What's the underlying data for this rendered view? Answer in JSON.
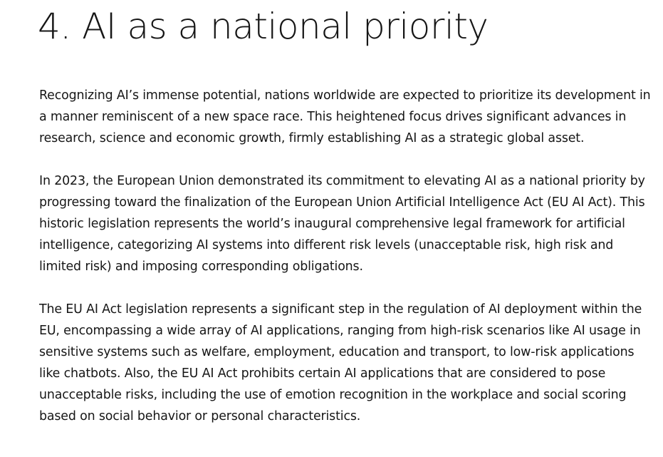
{
  "article": {
    "heading": "4. AI as a national priority",
    "paragraphs": [
      "Recognizing AI’s immense potential, nations worldwide are expected to prioritize its development in a manner reminiscent of a new space race. This heightened focus drives significant advances in research, science and economic growth, firmly establishing AI as a strategic global asset.",
      "In 2023, the European Union demonstrated its commitment to elevating AI as a national priority by progressing toward the finalization of the European Union Artificial Intelligence Act (EU AI Act). This historic legislation represents the world’s inaugural comprehensive legal framework for artificial intelligence, categorizing AI systems into different risk levels (unacceptable risk, high risk and limited risk) and imposing corresponding obligations.",
      "The EU AI Act legislation represents a significant step in the regulation of AI deployment within the EU, encompassing a wide array of AI applications, ranging from high-risk scenarios like AI usage in sensitive systems such as welfare, employment, education and transport, to low-risk applications like chatbots. Also, the EU AI Act prohibits certain AI applications that are considered to pose unacceptable risks, including the use of emotion recognition in the workplace and social scoring based on social behavior or personal characteristics."
    ]
  }
}
